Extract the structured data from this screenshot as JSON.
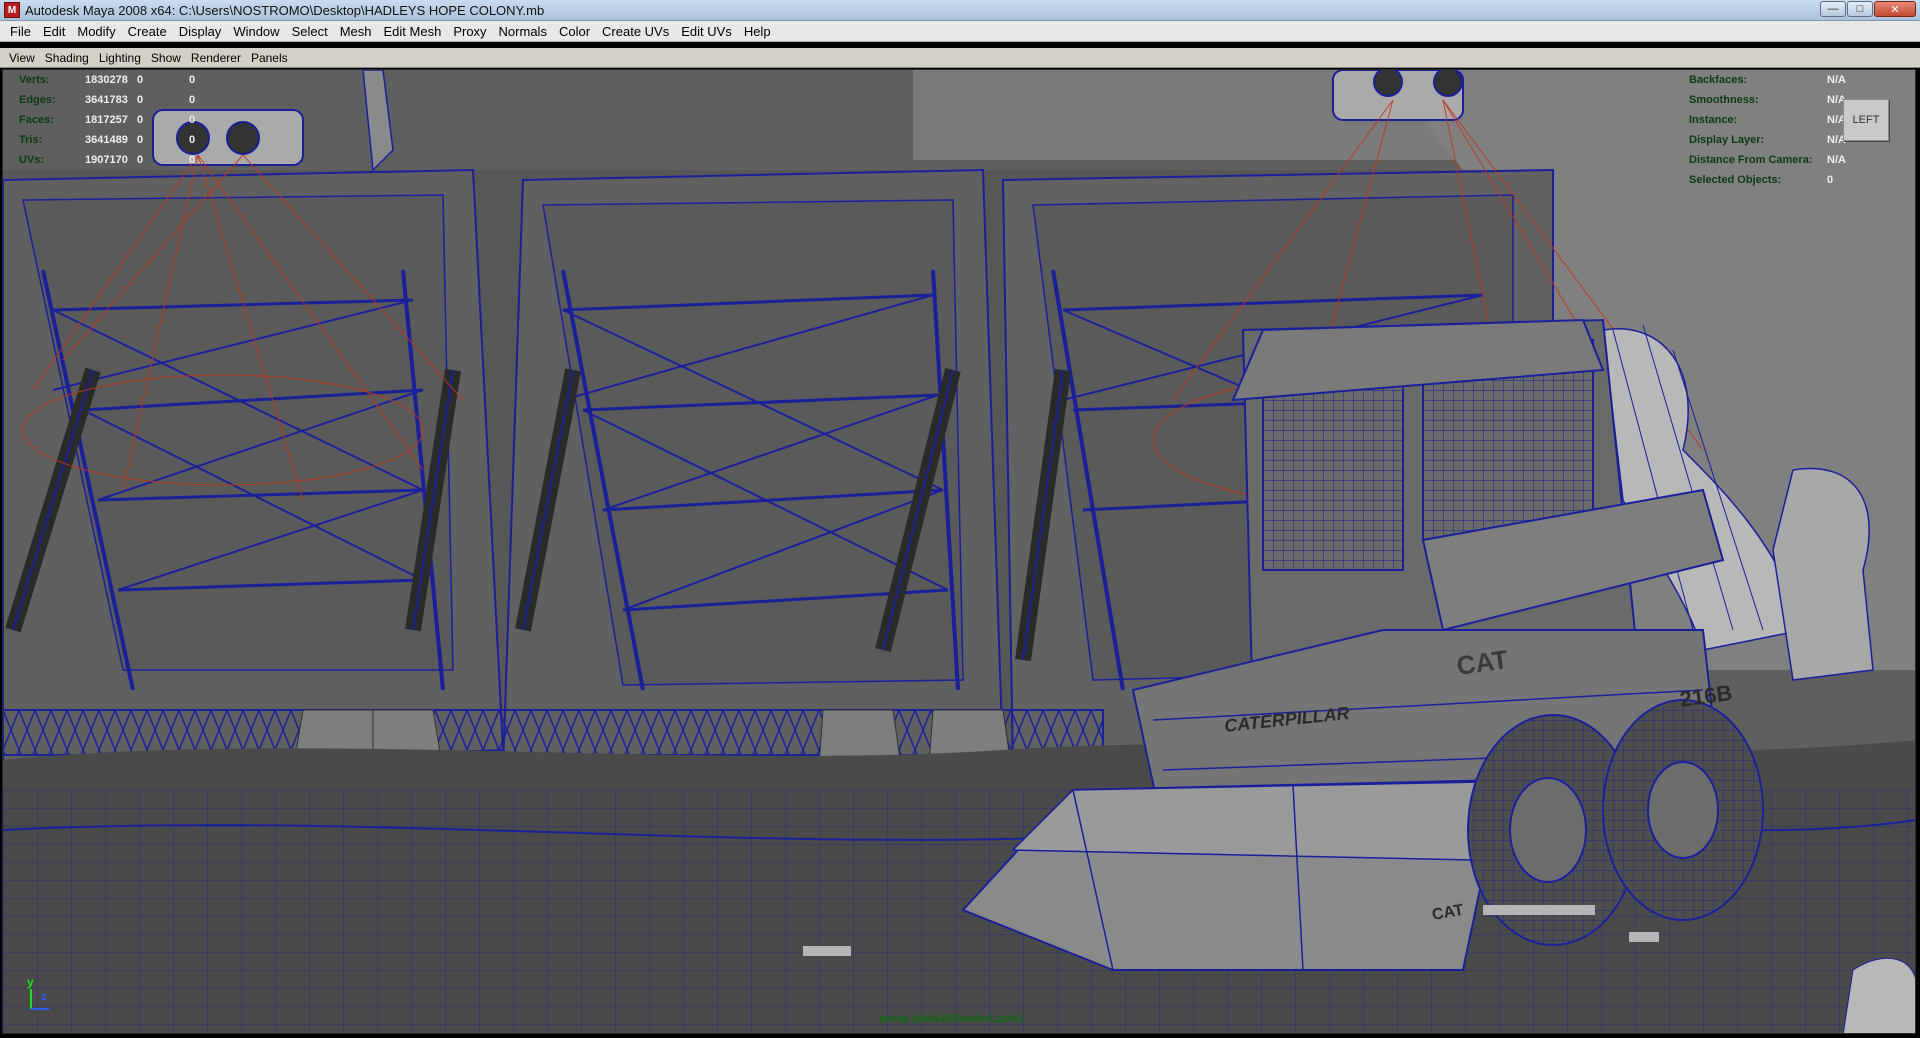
{
  "window": {
    "title": "Autodesk Maya 2008 x64: C:\\Users\\NOSTROMO\\Desktop\\HADLEYS HOPE COLONY.mb",
    "app_icon": "maya-icon",
    "minimize": "—",
    "maximize": "□",
    "close": "✕"
  },
  "menubar": {
    "items": [
      "File",
      "Edit",
      "Modify",
      "Create",
      "Display",
      "Window",
      "Select",
      "Mesh",
      "Edit Mesh",
      "Proxy",
      "Normals",
      "Color",
      "Create UVs",
      "Edit UVs",
      "Help"
    ]
  },
  "panel_menu": {
    "items": [
      "View",
      "Shading",
      "Lighting",
      "Show",
      "Renderer",
      "Panels"
    ]
  },
  "hud_left": {
    "verts": {
      "label": "Verts:",
      "value": "1830278",
      "sel": "0",
      "uv": "0"
    },
    "edges": {
      "label": "Edges:",
      "value": "3641783",
      "sel": "0",
      "uv": "0"
    },
    "faces": {
      "label": "Faces:",
      "value": "1817257",
      "sel": "0",
      "uv": "0"
    },
    "tris": {
      "label": "Tris:",
      "value": "3641489",
      "sel": "0",
      "uv": "0"
    },
    "uvs": {
      "label": "UVs:",
      "value": "1907170",
      "sel": "0",
      "uv": "0"
    }
  },
  "hud_right": {
    "backfaces": {
      "label": "Backfaces:",
      "value": "N/A"
    },
    "smoothness": {
      "label": "Smoothness:",
      "value": "N/A"
    },
    "instance": {
      "label": "Instance:",
      "value": "N/A"
    },
    "display_layer": {
      "label": "Display Layer:",
      "value": "N/A"
    },
    "distance": {
      "label": "Distance From Camera:",
      "value": "N/A"
    },
    "selected": {
      "label": "Selected Objects:",
      "value": "0"
    }
  },
  "view_cube": {
    "label": "LEFT"
  },
  "axis": {
    "y": "y",
    "z": "z"
  },
  "viewport_footer": {
    "layer": "persp (defaultRenderLayer)"
  },
  "model_decals": {
    "brand": "CATERPILLAR",
    "badge": "CAT",
    "model": "216B"
  },
  "colors": {
    "wire": "#1a1f9a",
    "light_lines": "#c0361c",
    "viewport_bg": "#5e5e5e",
    "hud_label": "#0c3a12"
  }
}
